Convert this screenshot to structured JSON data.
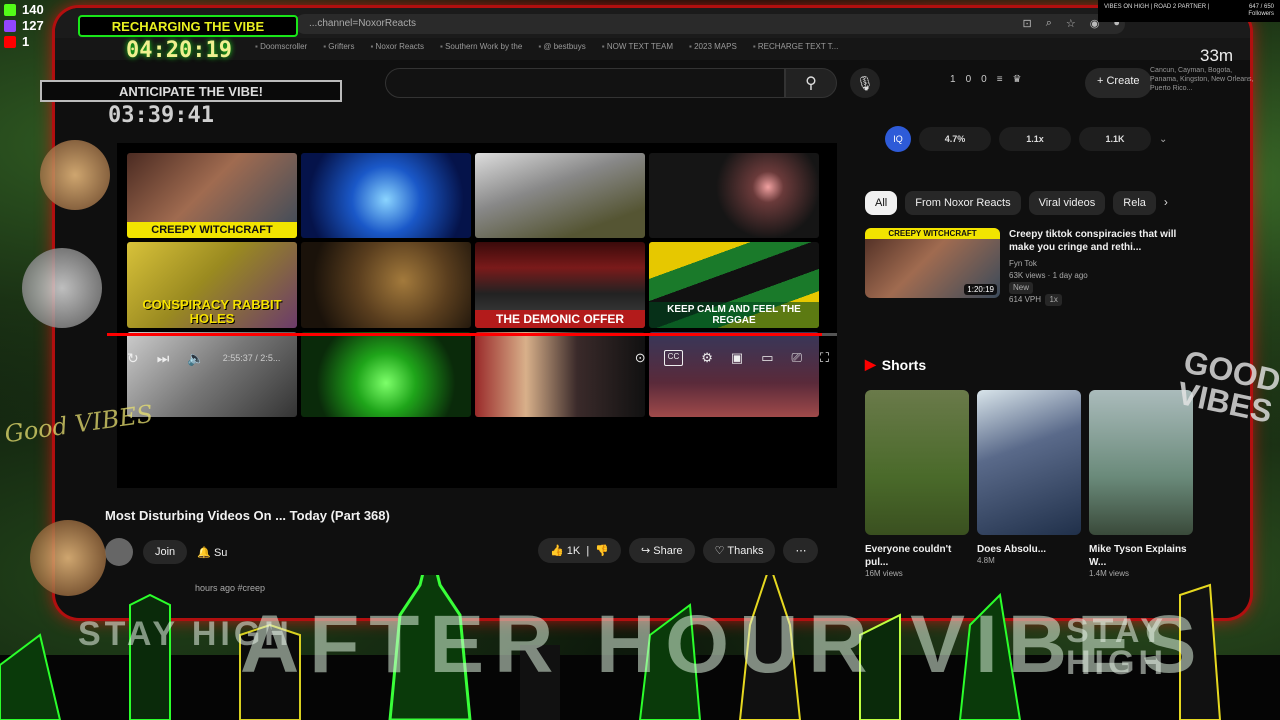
{
  "browser": {
    "url": "...channel=NoxorReacts",
    "bookmarks": [
      "Doomscroller",
      "Grifters",
      "Noxor Reacts",
      "Southern Work by the",
      "@ bestbuys",
      "NOW TEXT TEAM",
      "2023 MAPS",
      "RECHARGE TEXT T..."
    ]
  },
  "youtube": {
    "header_stats": [
      "1",
      "0",
      "0"
    ],
    "create_label": "Create",
    "video": {
      "title": "Most Disturbing Videos On ... Today (Part 368)",
      "time": "2:55:37 / 2:5...",
      "progress": 0.98,
      "description": "hours ago  #creep",
      "join_label": "Join",
      "subscribe_label": "Su",
      "like_count": "1K",
      "share_label": "Share",
      "thanks_label": "Thanks",
      "thumbnails": [
        {
          "caption": "CREEPY WITCHCRAFT"
        },
        {
          "caption": ""
        },
        {
          "caption": ""
        },
        {
          "caption": ""
        },
        {
          "caption": "CONSPIRACY RABBIT HOLES"
        },
        {
          "caption": ""
        },
        {
          "caption": "THE DEMONIC OFFER"
        },
        {
          "caption": "KEEP CALM AND FEEL THE REGGAE"
        },
        {
          "caption": ""
        },
        {
          "caption": ""
        },
        {
          "caption": ""
        },
        {
          "caption": ""
        }
      ]
    },
    "stats": {
      "a": "4.7%",
      "b": "1.1x",
      "c": "1.1K",
      "icon": "IQ"
    },
    "chips": [
      "All",
      "From Noxor Reacts",
      "Viral videos",
      "Rela"
    ],
    "recommended": {
      "caption": "CREEPY WITCHCRAFT",
      "duration": "1:20:19",
      "title": "Creepy tiktok conspiracies that will make you cringe and rethi...",
      "channel": "Fyn Tok",
      "meta": "63K views · 1 day ago",
      "badge1": "New",
      "vph": "614 VPH",
      "badge2": "1x"
    },
    "shorts_label": "Shorts",
    "shorts": [
      {
        "title": "Everyone couldn't pul...",
        "views": "16M views"
      },
      {
        "title": "Does Absolu...",
        "views": "4.8M"
      },
      {
        "title": "Mike Tyson Explains W...",
        "views": "1.4M views"
      }
    ]
  },
  "overlay": {
    "counters": [
      {
        "value": "140",
        "color": "#53fc18"
      },
      {
        "value": "127",
        "color": "#9146ff"
      },
      {
        "value": "1",
        "color": "#ff0000"
      }
    ],
    "recharge_title": "RECHARGING THE VIBE",
    "recharge_time": "04:20:19",
    "anticipate_title": "ANTICIPATE THE VIBE!",
    "anticipate_time": "03:39:41",
    "stream_title": "VIBES ON HIGH | ROAD 2 PARTNER |",
    "followers_count": "647 / 650",
    "followers_label": "Followers",
    "timer_right": "33m",
    "locations": "Cancun, Cayman, Bogota, Panama, Kingston, New Orleans, Puerto Rico...",
    "good_vibes_left": "Good VIBES",
    "good_vibes_right": "GOOD VIBES",
    "big_text": "AFTER HOUR VIBES",
    "stay_high": "STAY HIGH"
  }
}
